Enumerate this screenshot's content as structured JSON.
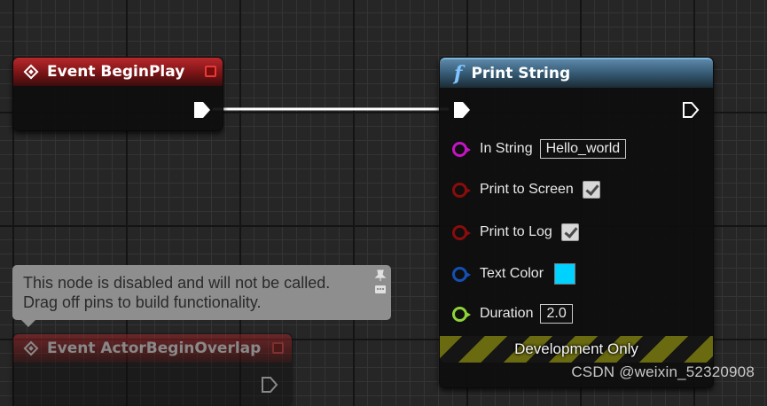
{
  "event_beginplay": {
    "title": "Event BeginPlay"
  },
  "print_string": {
    "title": "Print String",
    "pins": {
      "in_string": {
        "label": "In String",
        "value": "Hello_world",
        "color": "#c414c4"
      },
      "print_to_screen": {
        "label": "Print to Screen",
        "checked": true,
        "color": "#8a0c0c"
      },
      "print_to_log": {
        "label": "Print to Log",
        "checked": true,
        "color": "#8a0c0c"
      },
      "text_color": {
        "label": "Text Color",
        "value": "#00d2ff",
        "color": "#1450b4"
      },
      "duration": {
        "label": "Duration",
        "value": "2.0",
        "color": "#8ed438"
      }
    },
    "footer": "Development Only"
  },
  "disabled_tooltip": {
    "line1": "This node is disabled and will not be called.",
    "line2": "Drag off pins to build functionality."
  },
  "event_actorbeginoverlap": {
    "title": "Event ActorBeginOverlap"
  },
  "watermark": "CSDN @weixin_52320908",
  "colors": {
    "event_header": "#9a1a1e",
    "function_header": "#3d6580",
    "exec_wire": "#ffffff",
    "grid_background": "#262626"
  }
}
